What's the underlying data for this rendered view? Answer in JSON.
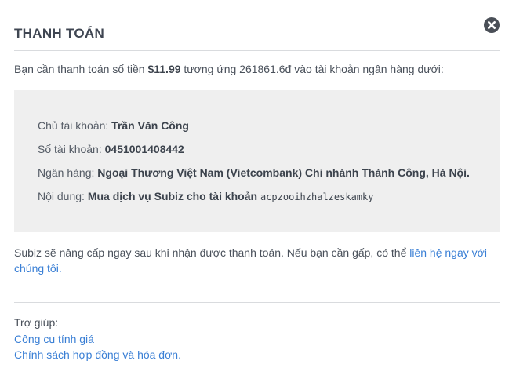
{
  "header": {
    "title": "THANH TOÁN",
    "close_icon": "close-circle-icon"
  },
  "intro": {
    "prefix": "Bạn cần thanh toán số tiền ",
    "amount": "$11.99",
    "middle": " tương ứng 261861.6đ vào tài khoản ngân hàng dưới:"
  },
  "bank": {
    "holder_label": "Chủ tài khoản: ",
    "holder_value": "Trần Văn Công",
    "number_label": "Số tài khoản: ",
    "number_value": "0451001408442",
    "bank_label": "Ngân hàng: ",
    "bank_value": "Ngoại Thương Việt Nam (Vietcombank) Chi nhánh Thành Công, Hà Nội.",
    "content_label": "Nội dung: ",
    "content_value": "Mua dịch vụ Subiz cho tài khoản ",
    "content_code": "acpzooihzhalzeskamky"
  },
  "note": {
    "text": "Subiz sẽ nâng cấp ngay sau khi nhận được thanh toán. Nếu bạn cần gấp, có thể ",
    "link": "liên hệ ngay với chúng tôi."
  },
  "help": {
    "title": "Trợ giúp:",
    "links": [
      "Công cụ tính giá",
      "Chính sách hợp đồng và hóa đơn."
    ]
  },
  "colors": {
    "link": "#3a7fd5",
    "box_bg": "#efefef",
    "close_icon": "#4a4f57"
  }
}
